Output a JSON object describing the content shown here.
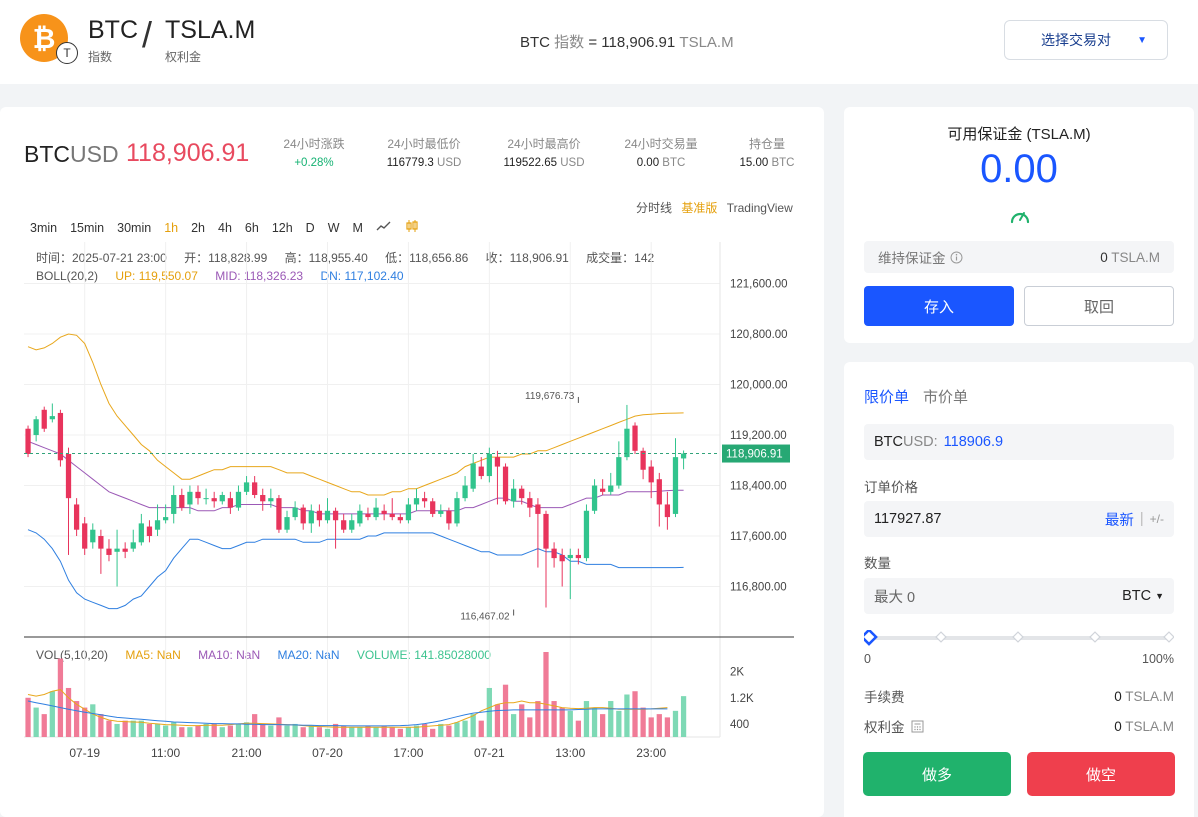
{
  "header": {
    "base_symbol": "BTC",
    "base_sub": "指数",
    "quote_symbol": "TSLA.M",
    "quote_sub": "权利金",
    "index_name": "BTC",
    "index_label": "指数",
    "index_value": "= 118,906.91",
    "index_unit": "TSLA.M",
    "select_pair_label": "选择交易对",
    "logo_letter": "₿",
    "quote_coin_letter": "T"
  },
  "ticker": {
    "base": "BTC",
    "quote": "USD",
    "price": "118,906.91",
    "stats": [
      {
        "label": "24小时涨跌",
        "value": "+0.28%",
        "unit": ""
      },
      {
        "label": "24小时最低价",
        "value": "116779.3",
        "unit": "USD"
      },
      {
        "label": "24小时最高价",
        "value": "119522.65",
        "unit": "USD"
      },
      {
        "label": "24小时交易量",
        "value": "0.00",
        "unit": "BTC"
      },
      {
        "label": "持仓量",
        "value": "15.00",
        "unit": "BTC"
      }
    ]
  },
  "chart_toolbar": {
    "views": [
      "分时线",
      "基准版",
      "TradingView"
    ],
    "active_view": "基准版",
    "intervals": [
      "3min",
      "15min",
      "30min",
      "1h",
      "2h",
      "4h",
      "6h",
      "12h",
      "D",
      "W",
      "M"
    ],
    "active_interval": "1h"
  },
  "ohlc_line": {
    "time": "时间：2025-07-21 23:00",
    "open": "开：118,828.99",
    "high": "高：118,955.40",
    "low": "低：118,656.86",
    "close": "收：118,906.91",
    "volume": "成交量：142"
  },
  "boll_line": {
    "name": "BOLL(20,2)",
    "up": "UP: 119,550.07",
    "mid": "MID: 118,326.23",
    "dn": "DN: 117,102.40"
  },
  "vol_line": {
    "name": "VOL(5,10,20)",
    "ma5": "MA5: NaN",
    "ma10": "MA10: NaN",
    "ma20": "MA20: NaN",
    "volume": "VOLUME: 141.85028000"
  },
  "colors": {
    "up": "#e8345c",
    "down": "#31c48d",
    "boll_up": "#e8a71c",
    "boll_mid": "#9b59b6",
    "boll_dn": "#2f7fe0",
    "accent": "#1a56ff"
  },
  "chart_data": {
    "type": "candlestick",
    "y_ticks": [
      "121,600.00",
      "120,800.00",
      "120,000.00",
      "119,200.00",
      "118,400.00",
      "117,600.00",
      "116,800.00"
    ],
    "y_tick_values": [
      121600,
      120800,
      120000,
      119200,
      118400,
      117600,
      116800
    ],
    "ylim": [
      116000,
      122100
    ],
    "x_ticks": [
      "07-19",
      "11:00",
      "21:00",
      "07-20",
      "17:00",
      "07-21",
      "13:00",
      "23:00"
    ],
    "x_tick_index": [
      7,
      17,
      27,
      37,
      47,
      57,
      67,
      77
    ],
    "current_price": 118906.91,
    "current_price_label": "118,906.91",
    "max_label": "119,676.73",
    "max_value": 119676.73,
    "max_index": 68,
    "min_label": "116,467.02",
    "min_value": 116467.02,
    "min_index": 60,
    "candles": [
      [
        119300,
        118900,
        119350,
        118850
      ],
      [
        119200,
        119450,
        119500,
        119100
      ],
      [
        119600,
        119300,
        119650,
        119250
      ],
      [
        119450,
        119500,
        119700,
        119400
      ],
      [
        119550,
        118800,
        119600,
        118700
      ],
      [
        118900,
        118200,
        119000,
        117300
      ],
      [
        118100,
        117700,
        118200,
        117600
      ],
      [
        117800,
        117400,
        117900,
        117300
      ],
      [
        117500,
        117700,
        117800,
        117400
      ],
      [
        117600,
        117400,
        117700,
        117000
      ],
      [
        117400,
        117300,
        117550,
        117200
      ],
      [
        117350,
        117400,
        117700,
        116800
      ],
      [
        117400,
        117350,
        117500,
        117250
      ],
      [
        117400,
        117500,
        117700,
        117350
      ],
      [
        117500,
        117800,
        117950,
        117450
      ],
      [
        117750,
        117600,
        117850,
        117500
      ],
      [
        117700,
        117850,
        118100,
        117600
      ],
      [
        117850,
        117900,
        118100,
        117800
      ],
      [
        117950,
        118250,
        118400,
        117800
      ],
      [
        118250,
        118050,
        118350,
        118000
      ],
      [
        118100,
        118300,
        118400,
        117950
      ],
      [
        118300,
        118200,
        118400,
        118100
      ],
      [
        118200,
        118200,
        118350,
        118100
      ],
      [
        118200,
        118150,
        118300,
        118050
      ],
      [
        118150,
        118250,
        118300,
        118100
      ],
      [
        118200,
        118050,
        118300,
        117950
      ],
      [
        118050,
        118300,
        118400,
        118000
      ],
      [
        118300,
        118450,
        118550,
        118250
      ],
      [
        118450,
        118250,
        118550,
        118200
      ],
      [
        118250,
        118150,
        118350,
        118000
      ],
      [
        118150,
        118200,
        118350,
        118050
      ],
      [
        118200,
        117700,
        118250,
        117650
      ],
      [
        117700,
        117900,
        118000,
        117650
      ],
      [
        117900,
        118050,
        118150,
        117850
      ],
      [
        118050,
        117800,
        118100,
        117700
      ],
      [
        117800,
        118000,
        118100,
        117650
      ],
      [
        118000,
        117850,
        118100,
        117750
      ],
      [
        117850,
        118000,
        118200,
        117800
      ],
      [
        118000,
        117850,
        118050,
        117400
      ],
      [
        117850,
        117700,
        117950,
        117650
      ],
      [
        117700,
        117850,
        117950,
        117650
      ],
      [
        117800,
        118000,
        118100,
        117750
      ],
      [
        117950,
        117900,
        118050,
        117850
      ],
      [
        117900,
        118050,
        118200,
        117850
      ],
      [
        118000,
        117950,
        118100,
        117850
      ],
      [
        117950,
        117900,
        118200,
        117850
      ],
      [
        117900,
        117850,
        117950,
        117800
      ],
      [
        117850,
        118100,
        118200,
        117800
      ],
      [
        118100,
        118200,
        118350,
        118000
      ],
      [
        118200,
        118150,
        118300,
        118050
      ],
      [
        118150,
        117950,
        118200,
        117900
      ],
      [
        117950,
        118000,
        118100,
        117900
      ],
      [
        118000,
        117800,
        118050,
        117700
      ],
      [
        117800,
        118200,
        118300,
        117750
      ],
      [
        118200,
        118400,
        118550,
        118150
      ],
      [
        118350,
        118750,
        118900,
        118300
      ],
      [
        118700,
        118550,
        118850,
        118500
      ],
      [
        118550,
        118900,
        119000,
        118450
      ],
      [
        118850,
        118700,
        118950,
        118100
      ],
      [
        118700,
        118150,
        118750,
        118100
      ],
      [
        118150,
        118350,
        118500,
        118050
      ],
      [
        118350,
        118200,
        118400,
        118100
      ],
      [
        118200,
        118050,
        118300,
        117900
      ],
      [
        118100,
        117950,
        118200,
        117100
      ],
      [
        117950,
        117400,
        118000,
        116467
      ],
      [
        117400,
        117250,
        117500,
        117100
      ],
      [
        117300,
        117200,
        117400,
        116800
      ],
      [
        117250,
        117300,
        117400,
        116600
      ],
      [
        117300,
        117250,
        117400,
        117150
      ],
      [
        117250,
        118000,
        118100,
        117200
      ],
      [
        118000,
        118400,
        118500,
        117950
      ],
      [
        118350,
        118300,
        118500,
        118250
      ],
      [
        118300,
        118400,
        118600,
        118250
      ],
      [
        118400,
        118850,
        119100,
        118350
      ],
      [
        118850,
        119300,
        119677,
        118800
      ],
      [
        119350,
        118950,
        119400,
        118900
      ],
      [
        118950,
        118650,
        119000,
        118500
      ],
      [
        118700,
        118450,
        118800,
        118200
      ],
      [
        118500,
        118100,
        118600,
        117750
      ],
      [
        118100,
        117900,
        118300,
        117700
      ],
      [
        117950,
        118850,
        119150,
        117900
      ],
      [
        118828.99,
        118906.91,
        118955.4,
        118656.86
      ]
    ],
    "boll_up": [
      120600,
      120550,
      120580,
      120650,
      120750,
      120800,
      120780,
      120650,
      120350,
      120000,
      119700,
      119500,
      119350,
      119200,
      119050,
      118950,
      118800,
      118700,
      118600,
      118500,
      118500,
      118550,
      118600,
      118650,
      118650,
      118700,
      118700,
      118700,
      118700,
      118700,
      118700,
      118650,
      118600,
      118600,
      118600,
      118550,
      118500,
      118450,
      118400,
      118350,
      118300,
      118300,
      118250,
      118250,
      118250,
      118300,
      118300,
      118350,
      118350,
      118400,
      118450,
      118500,
      118550,
      118600,
      118700,
      118750,
      118800,
      118850,
      118850,
      118850,
      118850,
      118900,
      118900,
      118950,
      118950,
      119000,
      119050,
      119100,
      119150,
      119200,
      119250,
      119300,
      119350,
      119400,
      119450,
      119500,
      119520,
      119530,
      119540,
      119545,
      119548,
      119550.07
    ],
    "boll_mid": [
      119100,
      119050,
      119000,
      118950,
      118900,
      118800,
      118700,
      118600,
      118500,
      118400,
      118300,
      118250,
      118200,
      118150,
      118100,
      118050,
      118050,
      118050,
      118050,
      118050,
      118050,
      118000,
      118000,
      118000,
      118050,
      118050,
      118100,
      118100,
      118100,
      118100,
      118100,
      118050,
      118050,
      118050,
      118000,
      118000,
      117950,
      117950,
      117950,
      117950,
      117950,
      117950,
      117950,
      117950,
      117950,
      117950,
      117950,
      117950,
      118000,
      118000,
      118000,
      118000,
      118000,
      118000,
      118050,
      118050,
      118100,
      118150,
      118200,
      118200,
      118150,
      118150,
      118100,
      118050,
      118050,
      118050,
      118050,
      118100,
      118150,
      118200,
      118200,
      118250,
      118250,
      118250,
      118300,
      118300,
      118300,
      118300,
      118310,
      118320,
      118324,
      118326.23
    ],
    "boll_dn": [
      117700,
      117650,
      117550,
      117400,
      117200,
      116900,
      116700,
      116600,
      116550,
      116500,
      116450,
      116450,
      116500,
      116600,
      116650,
      116800,
      116950,
      117050,
      117250,
      117400,
      117550,
      117550,
      117500,
      117450,
      117400,
      117400,
      117450,
      117500,
      117500,
      117550,
      117550,
      117550,
      117550,
      117550,
      117500,
      117500,
      117500,
      117550,
      117550,
      117550,
      117550,
      117550,
      117600,
      117600,
      117650,
      117650,
      117650,
      117650,
      117650,
      117650,
      117650,
      117600,
      117550,
      117500,
      117450,
      117400,
      117350,
      117350,
      117300,
      117300,
      117300,
      117300,
      117350,
      117400,
      117350,
      117350,
      117300,
      117200,
      117200,
      117150,
      117150,
      117150,
      117150,
      117100,
      117100,
      117100,
      117100,
      117100,
      117100,
      117100,
      117100,
      117102.4
    ],
    "vol_ticks": [
      "2K",
      "1.2K",
      "400"
    ],
    "vol_tick_values": [
      2000,
      1200,
      400
    ],
    "vol_ylim": [
      0,
      2600
    ],
    "volumes": [
      1200,
      900,
      700,
      1400,
      2400,
      1500,
      1100,
      900,
      1000,
      700,
      500,
      400,
      500,
      500,
      500,
      400,
      400,
      350,
      450,
      300,
      300,
      350,
      400,
      400,
      300,
      350,
      400,
      450,
      700,
      400,
      350,
      600,
      350,
      400,
      300,
      350,
      300,
      250,
      400,
      350,
      300,
      300,
      350,
      300,
      350,
      300,
      250,
      300,
      350,
      400,
      250,
      400,
      350,
      450,
      500,
      700,
      500,
      1500,
      1000,
      1600,
      700,
      1000,
      600,
      1100,
      2600,
      1100,
      900,
      800,
      500,
      1100,
      900,
      700,
      1100,
      800,
      1300,
      1400,
      900,
      600,
      700,
      600,
      800,
      1250
    ],
    "ma_vol_a": [
      1300,
      1250,
      1300,
      1400,
      1450,
      1200,
      1000,
      850,
      700,
      600,
      520,
      480,
      470,
      460,
      450,
      420,
      400,
      380,
      370,
      360,
      350,
      350,
      360,
      360,
      360,
      380,
      400,
      420,
      420,
      410,
      400,
      390,
      380,
      370,
      350,
      330,
      320,
      310,
      300,
      300,
      300,
      300,
      300,
      300,
      300,
      300,
      300,
      300,
      300,
      320,
      340,
      360,
      380,
      450,
      550,
      650,
      800,
      900,
      1000,
      1050,
      1050,
      1100,
      1050,
      1050,
      1000,
      950,
      900,
      880,
      870,
      880,
      900,
      900,
      880,
      850,
      850,
      850,
      850,
      860,
      880,
      900
    ],
    "ma_vol_b": [
      1100,
      1050,
      1000,
      950,
      900,
      850,
      800,
      760,
      720,
      680,
      640,
      600,
      580,
      560,
      540,
      520,
      500,
      480,
      460,
      450,
      440,
      430,
      420,
      410,
      410,
      400,
      400,
      390,
      390,
      380,
      380,
      380,
      370,
      370,
      360,
      360,
      350,
      350,
      350,
      345,
      340,
      340,
      340,
      340,
      340,
      345,
      350,
      360,
      380,
      410,
      450,
      500,
      560,
      620,
      680,
      730,
      760,
      790,
      810,
      820,
      830,
      830,
      830,
      830,
      830,
      830,
      830,
      830,
      840,
      850,
      860,
      860,
      860,
      860,
      860,
      860,
      860,
      860,
      860,
      860
    ]
  },
  "margin_panel": {
    "title": "可用保证金 (TSLA.M)",
    "amount": "0.00",
    "maint_label": "维持保证金",
    "maint_value": "0",
    "maint_unit": "TSLA.M",
    "deposit": "存入",
    "withdraw": "取回"
  },
  "order_panel": {
    "tabs": [
      "限价单",
      "市价单"
    ],
    "symbol_base": "BTC",
    "symbol_quote": "USD:",
    "symbol_price": "118906.9",
    "price_label": "订单价格",
    "price_value": "117927.87",
    "latest": "最新",
    "plus_minus": "+/-",
    "qty_label": "数量",
    "qty_placeholder": "最大 0",
    "qty_unit": "BTC",
    "slider_min": "0",
    "slider_max": "100%",
    "fee_label": "手续费",
    "fee_value": "0",
    "fee_unit": "TSLA.M",
    "premium_label": "权利金",
    "premium_value": "0",
    "premium_unit": "TSLA.M",
    "long": "做多",
    "short": "做空"
  }
}
